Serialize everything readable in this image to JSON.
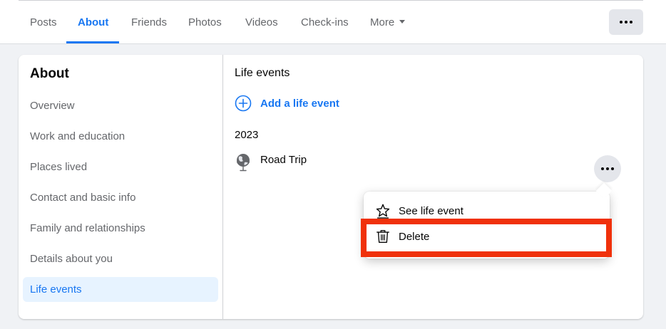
{
  "nav": {
    "tabs": [
      {
        "label": "Posts"
      },
      {
        "label": "About"
      },
      {
        "label": "Friends"
      },
      {
        "label": "Photos"
      },
      {
        "label": "Videos"
      },
      {
        "label": "Check-ins"
      },
      {
        "label": "More"
      }
    ],
    "active_tab": "About",
    "more_icon": "caret-down-icon",
    "overflow_icon": "more-horizontal-icon"
  },
  "sidebar": {
    "heading": "About",
    "items": [
      {
        "label": "Overview"
      },
      {
        "label": "Work and education"
      },
      {
        "label": "Places lived"
      },
      {
        "label": "Contact and basic info"
      },
      {
        "label": "Family and relationships"
      },
      {
        "label": "Details about you"
      },
      {
        "label": "Life events"
      }
    ],
    "active_item": "Life events"
  },
  "main": {
    "title": "Life events",
    "add_label": "Add a life event",
    "add_icon": "plus-circle-icon",
    "year": "2023",
    "event": {
      "name": "Road Trip",
      "icon": "globe-icon"
    },
    "event_menu_icon": "more-horizontal-icon"
  },
  "context_menu": {
    "items": [
      {
        "label": "See life event",
        "icon": "star-icon"
      },
      {
        "label": "Delete",
        "icon": "trash-icon"
      }
    ],
    "highlighted": "Delete"
  },
  "colors": {
    "accent": "#1877f2",
    "active_background": "#e7f3ff",
    "highlight_border": "#f0310b",
    "page_background": "#f0f2f5"
  }
}
